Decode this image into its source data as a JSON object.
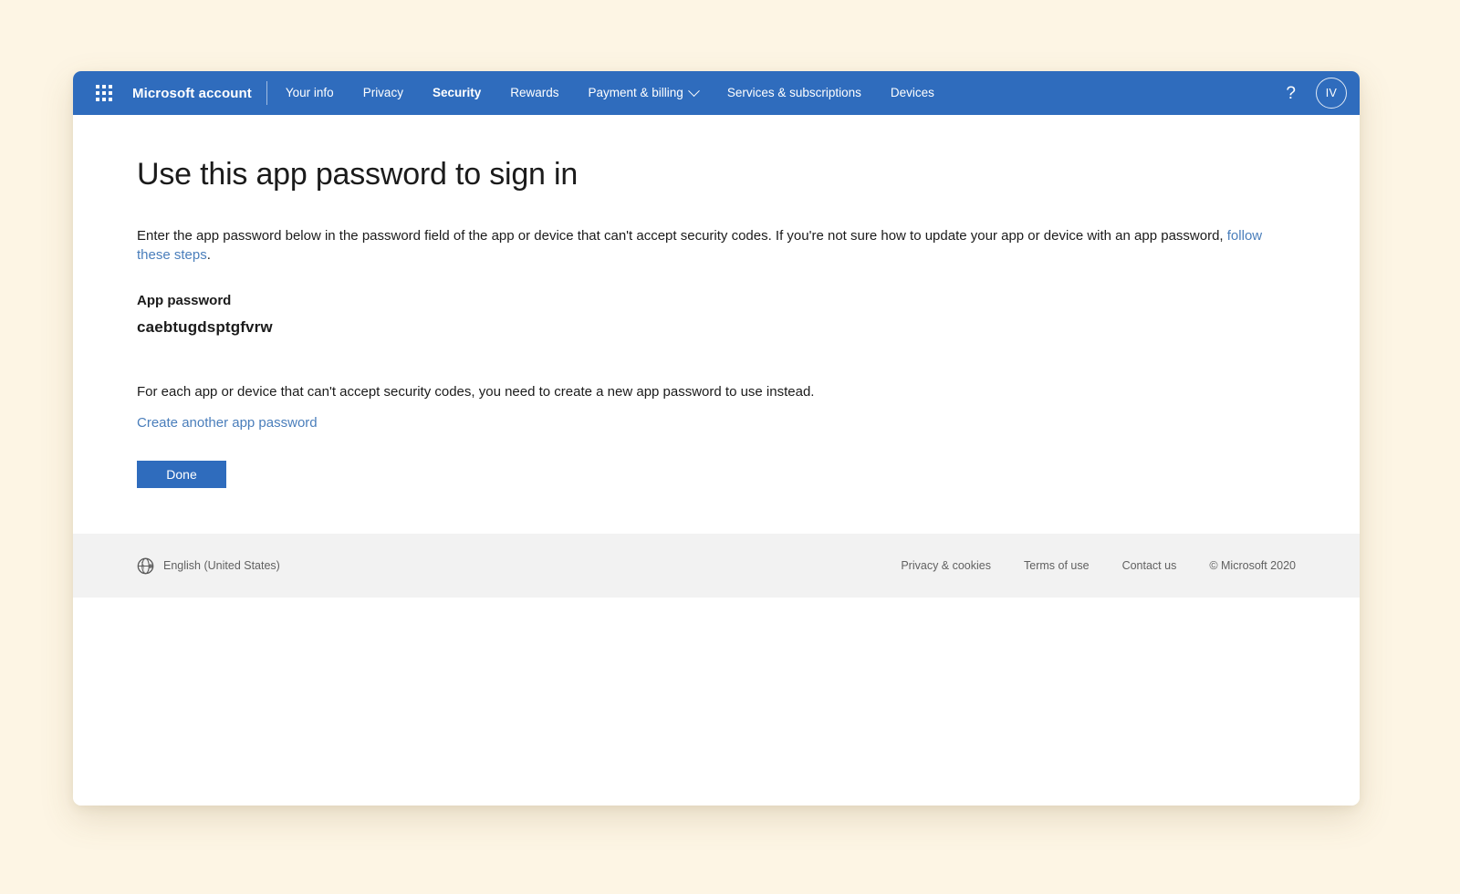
{
  "topnav": {
    "waffle_icon": "app-launcher-waffle-icon",
    "brand": "Microsoft account",
    "items": [
      {
        "label": "Your info",
        "active": false,
        "has_chevron": false
      },
      {
        "label": "Privacy",
        "active": false,
        "has_chevron": false
      },
      {
        "label": "Security",
        "active": true,
        "has_chevron": false
      },
      {
        "label": "Rewards",
        "active": false,
        "has_chevron": false
      },
      {
        "label": "Payment & billing",
        "active": false,
        "has_chevron": true
      },
      {
        "label": "Services & subscriptions",
        "active": false,
        "has_chevron": false
      },
      {
        "label": "Devices",
        "active": false,
        "has_chevron": false
      }
    ],
    "help_icon": "?",
    "avatar_initials": "IV",
    "bar_color": "#2f6cbd"
  },
  "main": {
    "title": "Use this app password to sign in",
    "intro_before_link": "Enter the app password below in the password field of the app or device that can't accept security codes. If you're not sure how to update your app or device with an app password, ",
    "intro_link": "follow these steps",
    "intro_after_link": ".",
    "password_label": "App password",
    "password_value": "caebtugdsptgfvrw",
    "note": "For each app or device that can't accept security codes, you need to create a new app password to use instead.",
    "create_another_label": "Create another app password",
    "done_label": "Done",
    "link_color": "#4a7ebb",
    "button_color": "#2f6cbd"
  },
  "footer": {
    "globe_icon": "globe-icon",
    "language": "English (United States)",
    "links": [
      "Privacy & cookies",
      "Terms of use",
      "Contact us"
    ],
    "copyright": "© Microsoft 2020"
  }
}
